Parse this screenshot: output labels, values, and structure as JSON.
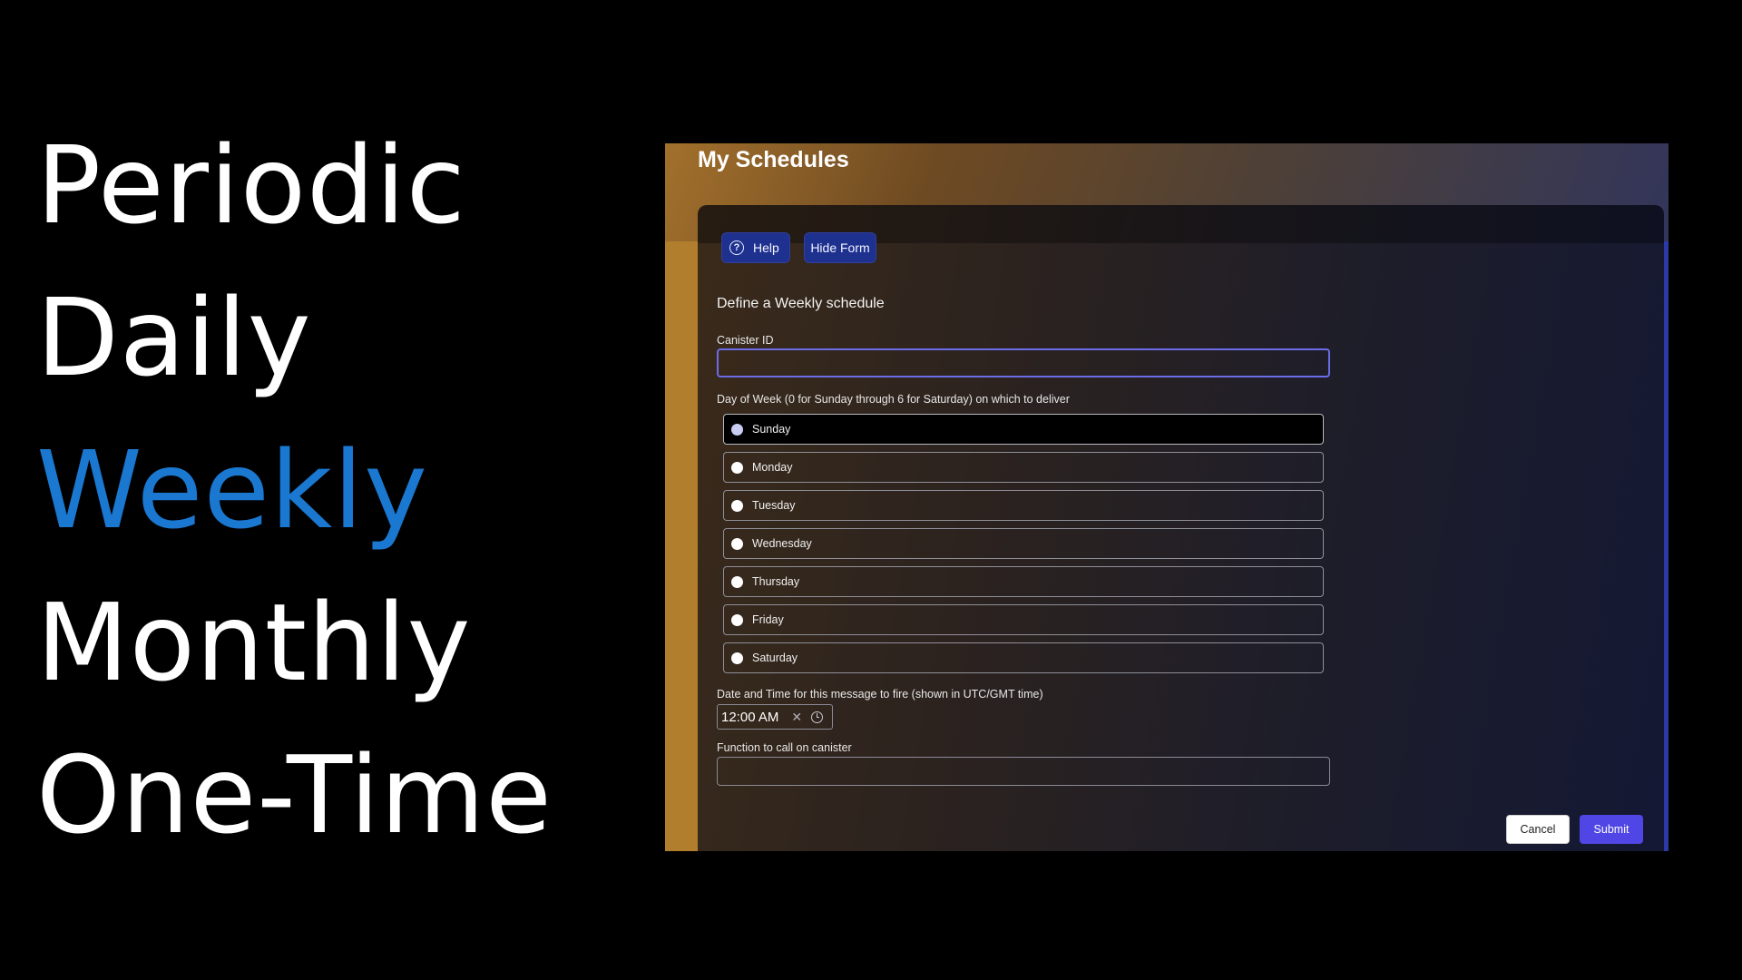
{
  "schedule_types": [
    {
      "label": "Periodic",
      "active": false
    },
    {
      "label": "Daily",
      "active": false
    },
    {
      "label": "Weekly",
      "active": true
    },
    {
      "label": "Monthly",
      "active": false
    },
    {
      "label": "One-Time",
      "active": false
    }
  ],
  "app": {
    "title": "My Schedules",
    "help_label": "Help",
    "hide_form_label": "Hide Form",
    "help_icon": "question-circle-icon"
  },
  "form": {
    "heading": "Define a Weekly schedule",
    "canister_label": "Canister ID",
    "canister_value": "",
    "day_label": "Day of Week (0 for Sunday through 6 for Saturday) on which to deliver",
    "days": [
      "Sunday",
      "Monday",
      "Tuesday",
      "Wednesday",
      "Thursday",
      "Friday",
      "Saturday"
    ],
    "selected_day": "Sunday",
    "time_label": "Date and Time for this message to fire (shown in UTC/GMT time)",
    "time_value": "12:00 AM",
    "function_label": "Function to call on canister",
    "function_value": "",
    "cancel_label": "Cancel",
    "submit_label": "Submit"
  },
  "colors": {
    "active_word": "#1a78d1",
    "button_blue": "#1f318f",
    "submit": "#4f46e5",
    "accent_strip": "#b07e2d"
  }
}
